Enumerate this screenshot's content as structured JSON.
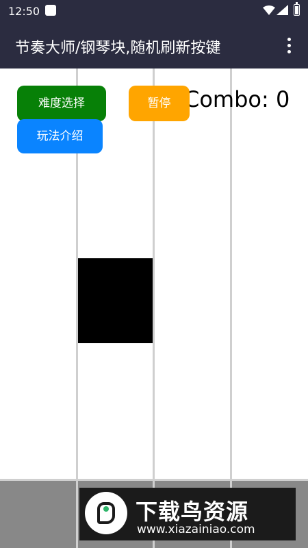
{
  "status_bar": {
    "time": "12:50",
    "icons": [
      "app-notification-icon",
      "wifi-icon",
      "cell-signal-icon",
      "battery-icon"
    ]
  },
  "app_bar": {
    "title": "节奏大师/钢琴块,随机刷新按键",
    "menu_icon": "overflow-menu-icon"
  },
  "game": {
    "lanes": 4,
    "buttons": {
      "difficulty": "难度选择",
      "howto": "玩法介绍",
      "pause": "暂停"
    },
    "combo_text": "Combo: 0",
    "active_tile_lane": 2
  },
  "watermark": {
    "title": "下载鸟资源",
    "url": "www.xiazainiao.com"
  },
  "colors": {
    "app_bar": "#2b2c40",
    "difficulty_button": "#078007",
    "howto_button": "#0a84ff",
    "pause_button": "#ffa500",
    "tile": "#000000",
    "lane_line": "#cfcfcf",
    "bottom_area": "#888888"
  }
}
